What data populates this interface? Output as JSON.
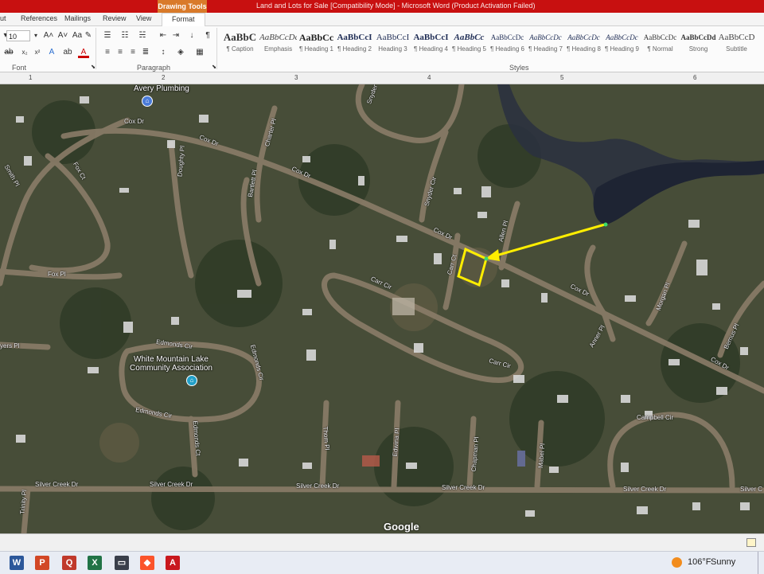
{
  "window": {
    "context_tab": "Drawing Tools",
    "title": "Land and Lots for Sale [Compatibility Mode] - Microsoft Word (Product Activation Failed)"
  },
  "ribbon_tabs": [
    "ut",
    "References",
    "Mailings",
    "Review",
    "View",
    "Format"
  ],
  "ribbon": {
    "font_group_label": "Font",
    "paragraph_group_label": "Paragraph",
    "styles_group_label": "Styles",
    "font_size": "10",
    "styles": [
      {
        "preview": "AaBbC",
        "name": "¶ Caption"
      },
      {
        "preview": "AaBbCcDc",
        "name": "Emphasis"
      },
      {
        "preview": "AaBbCc",
        "name": "¶ Heading 1"
      },
      {
        "preview": "AaBbCcI",
        "name": "¶ Heading 2"
      },
      {
        "preview": "AaBbCcI",
        "name": "Heading 3"
      },
      {
        "preview": "AaBbCcI",
        "name": "¶ Heading 4"
      },
      {
        "preview": "AaBbCc",
        "name": "¶ Heading 5"
      },
      {
        "preview": "AaBbCcDc",
        "name": "¶ Heading 6"
      },
      {
        "preview": "AaBbCcDc",
        "name": "¶ Heading 7"
      },
      {
        "preview": "AaBbCcDc",
        "name": "¶ Heading 8"
      },
      {
        "preview": "AaBbCcDc",
        "name": "¶ Heading 9"
      },
      {
        "preview": "AaBbCcDc",
        "name": "¶ Normal"
      },
      {
        "preview": "AaBbCcDd",
        "name": "Strong"
      },
      {
        "preview": "AaBbCcD",
        "name": "Subtitle"
      }
    ]
  },
  "ruler": {
    "numbers": [
      "1",
      "2",
      "3",
      "4",
      "5",
      "6"
    ]
  },
  "map": {
    "streets": {
      "cox_dr_1": "Cox Dr",
      "cox_dr_2": "Cox Dr",
      "cox_dr_3": "Cox Dr",
      "cox_dr_4": "Cox Dr",
      "cox_dr_5": "Cox Dr",
      "fox_ct": "Fox Ct",
      "fox_pl": "Fox Pl",
      "smith_pl": "Smith Pl",
      "doughty_pl": "Doughty Pl",
      "charter_pl": "Charter Pl",
      "bartlett_pl": "Bartlett Pl",
      "snyder_cir": "Snyder Cir",
      "snyder_top": "Snyder",
      "carr_cir_1": "Carr Cir",
      "carr_cir_2": "Carr Cir",
      "carr_ct": "Carr Ct",
      "allen_pl": "Allen Pl",
      "morgan_pl": "Morgan Pl",
      "bemus_pl": "Bemus Pl",
      "anner_pl": "Anner Pl",
      "edmonds_cir_1": "Edmonds Cir",
      "edmonds_cir_2": "Edmonds Cir",
      "edmonds_cir_3": "Edmonds Cir",
      "edmonds_ct": "Edmonds Ct",
      "myers_pl": "yers Pl",
      "campbell_cir": "Campbell Cir",
      "silver_creek_1": "Silver Creek Dr",
      "silver_creek_2": "Silver Creek Dr",
      "silver_creek_3": "Silver Creek Dr",
      "silver_creek_4": "Silver Creek Dr",
      "silver_creek_5": "Silver Creek Dr",
      "silver_creek_6": "Silver C",
      "thom_pl": "Thom Pl",
      "edwina_pl": "Edwina Pl",
      "chapman_pl": "Chapman Pl",
      "mabel_pl": "Mabel Pl",
      "trinity_pl": "Trinity Pl"
    },
    "pois": {
      "avery": "Avery Plumbing",
      "whitemtn_line1": "White Mountain Lake",
      "whitemtn_line2": "Community Association"
    },
    "attribution": "Google"
  },
  "taskbar": {
    "apps": [
      "W",
      "P",
      "Q",
      "X",
      "▭",
      "◆",
      "A"
    ],
    "weather_temp": "106°F",
    "weather_condition": "Sunny"
  },
  "colors": {
    "title_bar": "#c81010",
    "context_tab": "#d97a2a",
    "highlight": "#ffee00"
  }
}
